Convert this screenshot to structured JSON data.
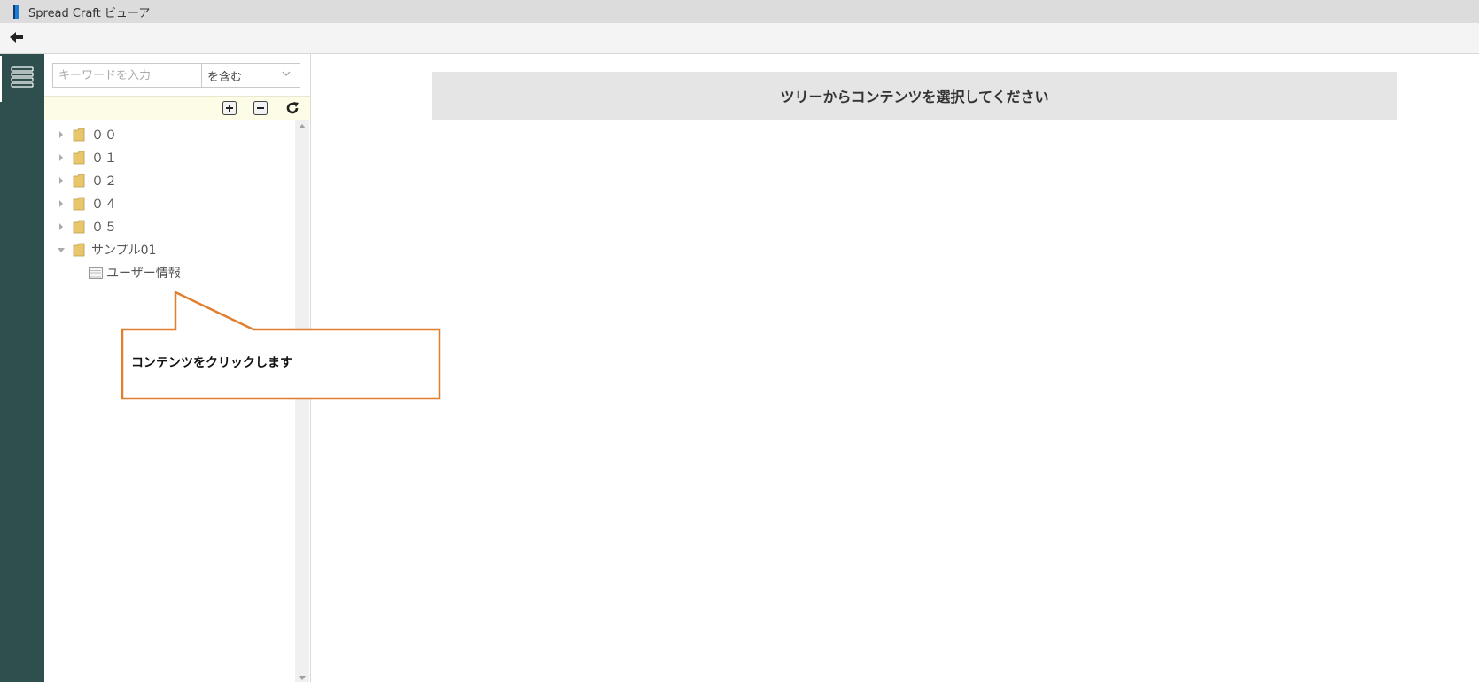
{
  "window": {
    "title": "Spread Craft ビューア"
  },
  "search": {
    "placeholder": "キーワードを入力",
    "value": "",
    "match_mode": "を含む"
  },
  "tree": {
    "items": [
      {
        "label": "００",
        "expanded": false
      },
      {
        "label": "０１",
        "expanded": false
      },
      {
        "label": "０２",
        "expanded": false
      },
      {
        "label": "０４",
        "expanded": false
      },
      {
        "label": "０５",
        "expanded": false
      },
      {
        "label": "サンプル01",
        "expanded": true,
        "children": [
          {
            "label": "ユーザー情報"
          }
        ]
      }
    ]
  },
  "main": {
    "banner": "ツリーからコンテンツを選択してください"
  },
  "callout": {
    "text": "コンテンツをクリックします",
    "border_color": "#e07f2e"
  },
  "colors": {
    "rail": "#2f4f4f",
    "titlebar": "#dcdcdc",
    "toolbar_strip": "#fdfde7",
    "banner": "#e5e5e5"
  }
}
